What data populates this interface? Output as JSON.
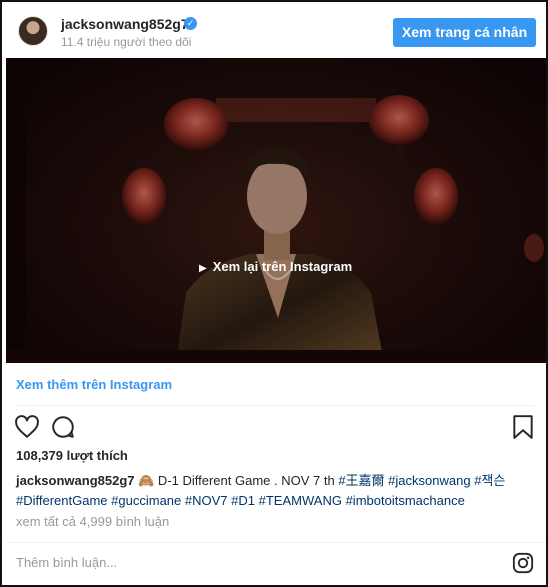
{
  "header": {
    "username": "jacksonwang852g7",
    "verified_glyph": "✓",
    "followers": "11.4 triệu người theo dõi",
    "view_profile_label": "Xem trang cá nhân"
  },
  "media": {
    "overlay_label": "Xem lại trên Instagram",
    "play_glyph": "▶"
  },
  "more_link": "Xem thêm trên Instagram",
  "actions": {
    "icons": [
      "heart-icon",
      "comment-icon",
      "bookmark-icon"
    ]
  },
  "likes": "108,379 lượt thích",
  "caption": {
    "username": "jacksonwang852g7",
    "emoji": "🙈",
    "text": " D-1 Different Game . NOV 7 th ",
    "tags_line1": [
      "#王嘉爾",
      "#jacksonwang",
      "#잭슨"
    ],
    "tags_line2": [
      "#DifferentGame",
      "#guccimane",
      "#NOV7",
      "#D1",
      "#TEAMWANG",
      "#imbotoitsmachance"
    ]
  },
  "comments_link": "xem tất cả 4,999 bình luận",
  "comment_placeholder": "Thêm bình luận...",
  "colors": {
    "accent": "#3897f0",
    "hashtag": "#003569",
    "muted": "#999999"
  }
}
